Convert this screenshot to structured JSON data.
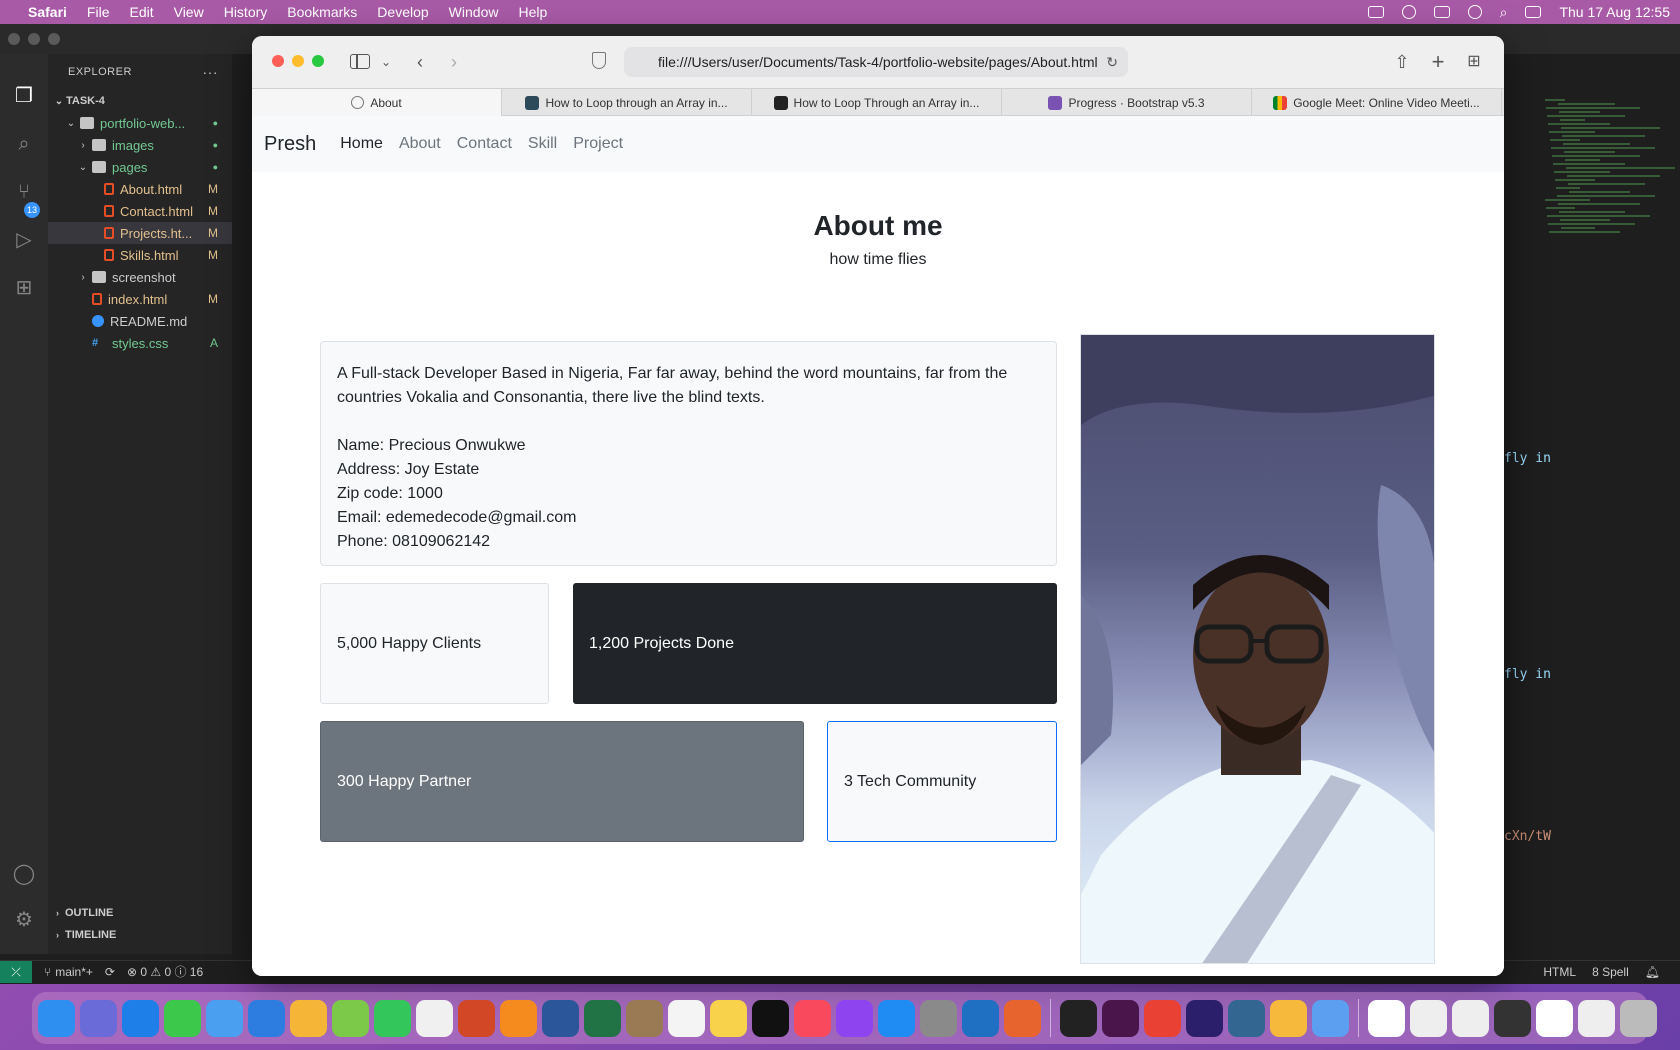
{
  "menubar": {
    "app": "Safari",
    "items": [
      "File",
      "Edit",
      "View",
      "History",
      "Bookmarks",
      "Develop",
      "Window",
      "Help"
    ],
    "clock": "Thu 17 Aug  12:55"
  },
  "vscode": {
    "explorer_title": "EXPLORER",
    "workspace": "TASK-4",
    "scm_badge": "13",
    "tree": [
      {
        "label": "portfolio-web...",
        "status": "●",
        "kind": "folder",
        "depth": 1,
        "open": true
      },
      {
        "label": "images",
        "status": "●",
        "kind": "folder",
        "depth": 2,
        "open": false
      },
      {
        "label": "pages",
        "status": "●",
        "kind": "folder",
        "depth": 2,
        "open": true
      },
      {
        "label": "About.html",
        "status": "M",
        "kind": "html",
        "depth": 3
      },
      {
        "label": "Contact.html",
        "status": "M",
        "kind": "html",
        "depth": 3
      },
      {
        "label": "Projects.ht...",
        "status": "M",
        "kind": "html",
        "depth": 3,
        "selected": true
      },
      {
        "label": "Skills.html",
        "status": "M",
        "kind": "html",
        "depth": 3
      },
      {
        "label": "screenshot",
        "status": "",
        "kind": "folder",
        "depth": 2,
        "open": false
      },
      {
        "label": "index.html",
        "status": "M",
        "kind": "html",
        "depth": 2
      },
      {
        "label": "README.md",
        "status": "",
        "kind": "info",
        "depth": 2
      },
      {
        "label": "styles.css",
        "status": "A",
        "kind": "css",
        "depth": 2
      }
    ],
    "outline_label": "OUTLINE",
    "timeline_label": "TIMELINE",
    "status_branch": "main*+",
    "status_problems": "⊗ 0 ⚠ 0 ⓘ 16",
    "status_lang": "HTML",
    "status_spell": "8 Spell",
    "editor_snips": [
      "fly in",
      "fly in",
      "cXn/tW"
    ]
  },
  "safari": {
    "url": "file:///Users/user/Documents/Task-4/portfolio-website/pages/About.html",
    "tabs": [
      {
        "title": "About",
        "fav": "compass",
        "active": true
      },
      {
        "title": "How to Loop through an Array in...",
        "fav": "w3"
      },
      {
        "title": "How to Loop Through an Array in...",
        "fav": "dark"
      },
      {
        "title": "Progress · Bootstrap v5.3",
        "fav": "bs"
      },
      {
        "title": "Google Meet: Online Video Meeti...",
        "fav": "meet"
      }
    ]
  },
  "page": {
    "brand": "Presh",
    "nav": [
      "Home",
      "About",
      "Contact",
      "Skill",
      "Project"
    ],
    "title": "About me",
    "subtitle": "how time flies",
    "bio": "A Full-stack Developer Based in Nigeria, Far far away, behind the word mountains, far from the countries Vokalia and Consonantia, there live the blind texts.",
    "details": [
      "Name: Precious Onwukwe",
      "Address: Joy Estate",
      "Zip code: 1000",
      "Email: edemedecode@gmail.com",
      "Phone: 08109062142"
    ],
    "stats": {
      "clients": "5,000 Happy Clients",
      "projects": "1,200 Projects Done",
      "partners": "300 Happy Partner",
      "community": "3 Tech Community"
    }
  },
  "dock": {
    "colors": [
      "#2f8ff0",
      "#6a6ad8",
      "#1e7fe8",
      "#3cc84a",
      "#4a9ff0",
      "#2d7de0",
      "#f5b638",
      "#7cc94a",
      "#33c65a",
      "#f0f0f0",
      "#d24726",
      "#f58a1f",
      "#2b579a",
      "#217346",
      "#9a7a55",
      "#f4f4f4",
      "#f7d24a",
      "#111111",
      "#f84a5c",
      "#8e44ef",
      "#1e8cf3",
      "#8a8a8a",
      "#1f6fc2",
      "#e8642f",
      "#222222",
      "#4a154b",
      "#e94235",
      "#2b1f6b",
      "#336791",
      "#f6b93b",
      "#5c9ef0",
      "#ffffff",
      "#eeeeee",
      "#eeeeee",
      "#333333",
      "#ffffff",
      "#eeeeee",
      "#bbbbbb"
    ]
  }
}
